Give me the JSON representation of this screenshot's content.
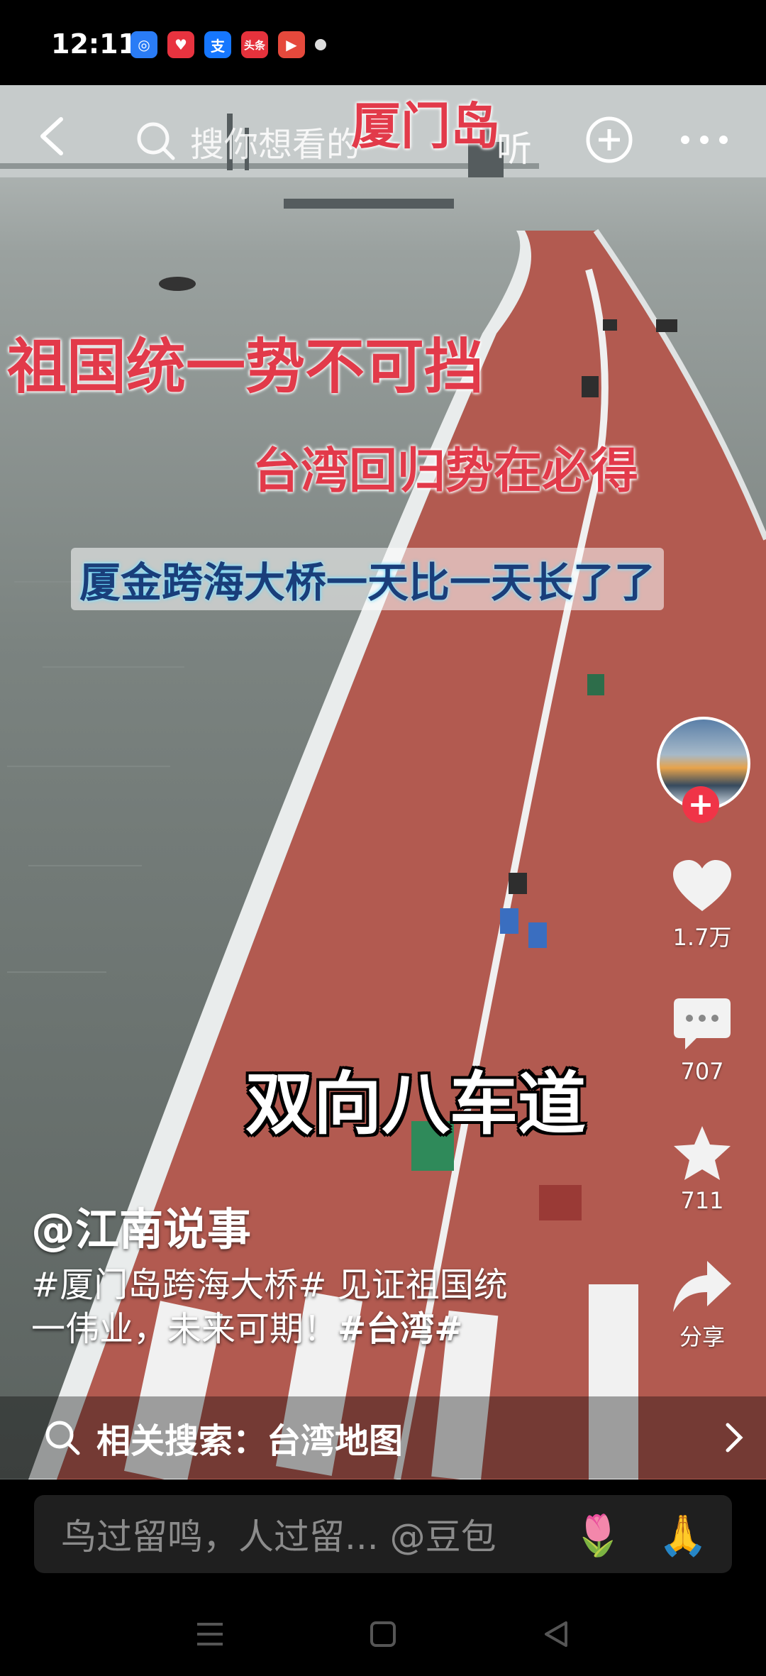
{
  "status_bar": {
    "time": "12:11",
    "apps": [
      {
        "name": "browser-app-icon",
        "glyph": "◎",
        "color": "#2a7cf6"
      },
      {
        "name": "heart-app-icon",
        "glyph": "♥",
        "color": "#e8333f"
      },
      {
        "name": "alipay-app-icon",
        "glyph": "支",
        "color": "#1677ff"
      },
      {
        "name": "toutiao-app-icon",
        "glyph": "头条",
        "color": "#e5323c"
      },
      {
        "name": "video-app-icon",
        "glyph": "▶",
        "color": "#e5493c"
      }
    ]
  },
  "top_bar": {
    "search_placeholder": "搜你想看的",
    "listen_label": "听",
    "location_caption": "厦门岛"
  },
  "captions": {
    "line1": "祖国统一势不可挡",
    "line2": "台湾回归势在必得",
    "line3": "厦金跨海大桥一天比一天长了了",
    "line4": "双向八车道"
  },
  "actions": {
    "like_count": "1.7万",
    "comment_count": "707",
    "favorite_count": "711",
    "share_label": "分享"
  },
  "post": {
    "author": "@江南说事",
    "hashtag1": "#厦门岛跨海大桥#",
    "desc_line1_rest": " 见证祖国统",
    "desc_line2": "一伟业，未来可期！",
    "hashtag2": "#台湾#"
  },
  "related_search": {
    "label": "相关搜索：台湾地图"
  },
  "comment_bar": {
    "placeholder": "鸟过留鸣，人过留... @豆包",
    "emoji1": "🌷",
    "emoji2": "🙏"
  }
}
